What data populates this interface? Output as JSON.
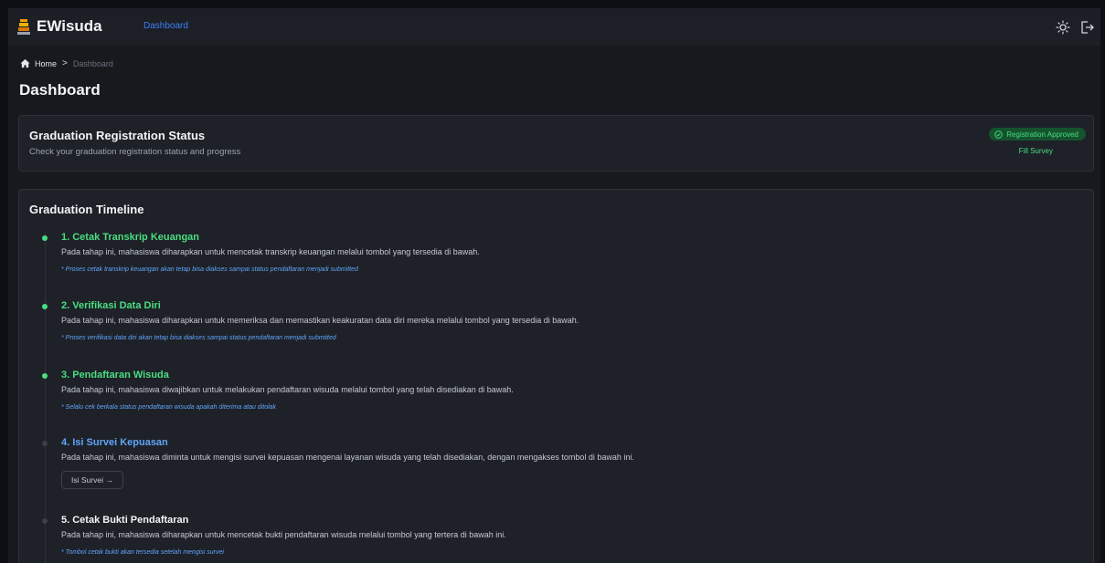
{
  "app": {
    "name": "EWisuda",
    "top_tab": "Dashboard"
  },
  "breadcrumb": {
    "home": "Home",
    "separator": ">",
    "current": "Dashboard"
  },
  "page_title": "Dashboard",
  "status_card": {
    "title": "Graduation Registration Status",
    "description": "Check your graduation registration status and progress",
    "badge": "Registration Approved",
    "link": "Fill Survey"
  },
  "timeline": {
    "title": "Graduation Timeline",
    "steps": [
      {
        "title": "1. Cetak Transkrip Keuangan",
        "description": "Pada tahap ini, mahasiswa diharapkan untuk mencetak transkrip keuangan melalui tombol yang tersedia di bawah.",
        "note": "* Proses cetak transkrip keuangan akan tetap bisa diakses sampai status pendaftaran menjadi submitted",
        "state": "done"
      },
      {
        "title": "2. Verifikasi Data Diri",
        "description": "Pada tahap ini, mahasiswa diharapkan untuk memeriksa dan memastikan keakuratan data diri mereka melalui tombol yang tersedia di bawah.",
        "note": "* Proses verifikasi data diri akan tetap bisa diakses sampai status pendaftaran menjadi submitted",
        "state": "done"
      },
      {
        "title": "3. Pendaftaran Wisuda",
        "description": "Pada tahap ini, mahasiswa diwajibkan untuk melakukan pendaftaran wisuda melalui tombol yang telah disediakan di bawah.",
        "note": "* Selalu cek berkala status pendaftaran wisuda apakah diterima atau ditolak",
        "state": "done"
      },
      {
        "title": "4. Isi Survei Kepuasan",
        "description": "Pada tahap ini, mahasiswa diminta untuk mengisi survei kepuasan mengenai layanan wisuda yang telah disediakan, dengan mengakses tombol di bawah ini.",
        "button": "Isi Survei →",
        "state": "current"
      },
      {
        "title": "5. Cetak Bukti Pendaftaran",
        "description": "Pada tahap ini, mahasiswa diharapkan untuk mencetak bukti pendaftaran wisuda melalui tombol yang tertera di bawah ini.",
        "note": "* Tombol cetak bukti akan tersedia setelah mengisi survei",
        "state": "pending"
      }
    ]
  },
  "colors": {
    "accent_green": "#4ade80",
    "accent_blue": "#60a5fa",
    "background": "#17191e",
    "card": "#1e2128"
  },
  "icons": [
    "graduation-logo-icon",
    "sun-icon",
    "logout-icon",
    "home-icon",
    "check-circle-icon"
  ]
}
